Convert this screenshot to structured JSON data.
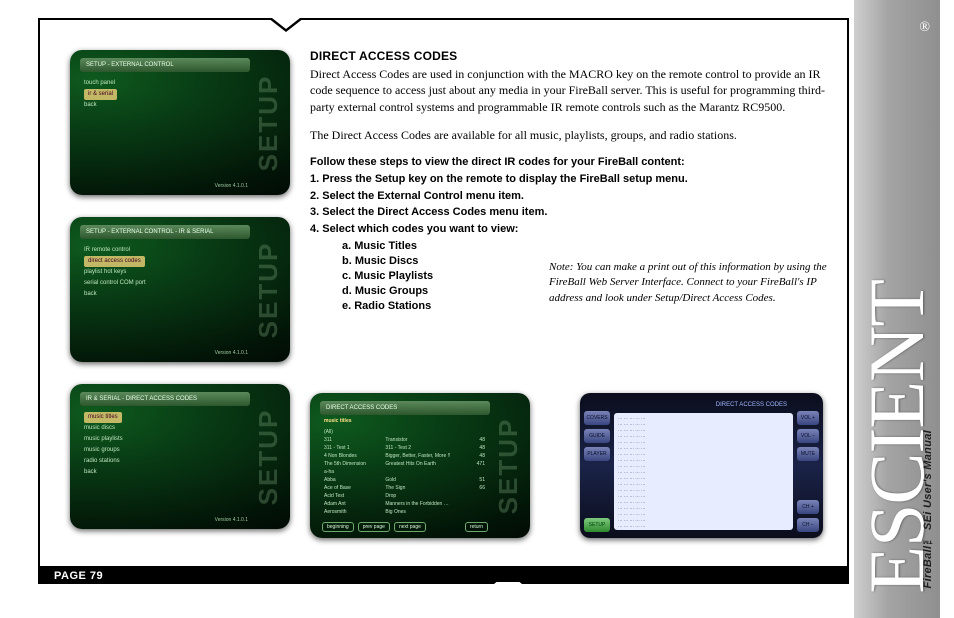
{
  "page_number_label": "PAGE 79",
  "brand": {
    "name": "ESCIENT",
    "registered": "®",
    "subtitle": "FireBall™ SEi User's Manual"
  },
  "heading": "DIRECT ACCESS CODES",
  "para1": "Direct Access Codes are used in conjunction with the MACRO key on the remote control to provide an IR code sequence to access just about any media in your FireBall server. This is useful for programming third-party external control systems and programmable IR remote controls such as the Marantz RC9500.",
  "para2": "The Direct Access Codes are available for all music, playlists, groups, and radio stations.",
  "steps_intro": "Follow these steps to view the direct IR codes for your FireBall content:",
  "steps": [
    "1.  Press the Setup key on the remote to display the FireBall setup menu.",
    "2.  Select the External Control menu item.",
    "3.  Select the Direct Access Codes menu item.",
    "4.  Select which codes you want to view:"
  ],
  "substeps": [
    "a.  Music Titles",
    "b.  Music Discs",
    "c.  Music Playlists",
    "d.  Music Groups",
    "e.  Radio Stations"
  ],
  "note": "Note: You can make a print out of this information by using the FireBall Web Server Interface. Connect to your FireBall's IP address and look under Setup/Direct Access Codes.",
  "thumbs": {
    "setup_label": "SETUP",
    "version": "Version 4.1.0.1",
    "t1": {
      "header": "SETUP - EXTERNAL CONTROL",
      "lines": [
        "touch panel",
        "ir & serial",
        "back"
      ]
    },
    "t2": {
      "header": "SETUP - EXTERNAL CONTROL - IR & SERIAL",
      "lines": [
        "IR remote control",
        "direct access codes",
        "playlist hot keys",
        "serial control COM port",
        "back"
      ]
    },
    "t3": {
      "header": "IR & SERIAL - DIRECT ACCESS CODES",
      "lines": [
        "music titles",
        "music discs",
        "music playlists",
        "music groups",
        "radio stations",
        "back"
      ]
    },
    "t4": {
      "header": "DIRECT ACCESS CODES",
      "subtitle": "music titles",
      "cols": [
        [
          "(All)",
          "311",
          "311 - Test 1",
          "4 Non Blondes",
          "The 5th Dimension",
          "a-ha",
          "Abba",
          "Ace of Base",
          "Acid Test",
          "Adam Ant",
          "Aerosmith"
        ],
        [
          "",
          "Transistor",
          "311 - Test 2",
          "Bigger, Better, Faster, More !!",
          "Greatest Hits On Earth",
          "",
          "Gold",
          "The Sign",
          "Drop",
          "Manners in the Forbidden …",
          "Big Ones"
        ],
        [
          "",
          "48",
          "48",
          "48",
          "471",
          "",
          "51",
          "66",
          "",
          "",
          ""
        ]
      ],
      "buttons": [
        "beginning",
        "prev page",
        "next page",
        "return"
      ]
    },
    "t5": {
      "header": "DIRECT ACCESS CODES",
      "left_buttons": [
        "COVERS",
        "GUIDE",
        "PLAYER",
        "",
        "SETUP"
      ],
      "right_buttons": [
        "VOL +",
        "VOL −",
        "MUTE",
        "",
        "",
        "CH +",
        "CH −"
      ]
    }
  }
}
